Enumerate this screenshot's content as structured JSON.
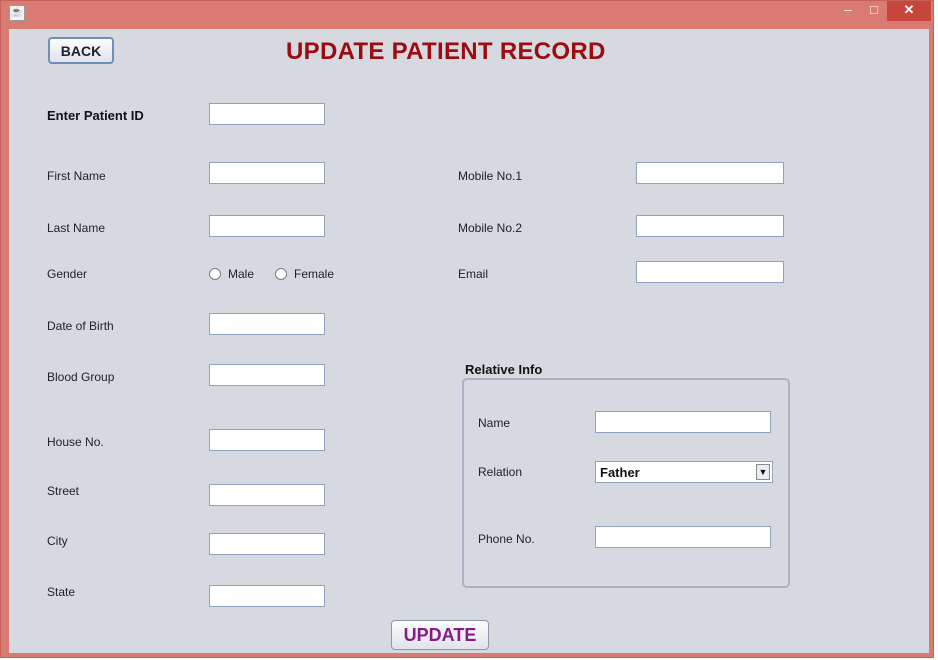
{
  "window": {
    "title": "",
    "controls": {
      "minimize": "–",
      "maximize": "□",
      "close": "✕"
    }
  },
  "header": {
    "back_label": "BACK",
    "title": "UPDATE PATIENT RECORD"
  },
  "form": {
    "patient_id_label": "Enter Patient ID",
    "first_name_label": "First Name",
    "last_name_label": "Last Name",
    "gender_label": "Gender",
    "gender_options": [
      "Male",
      "Female"
    ],
    "dob_label": "Date of Birth",
    "blood_group_label": "Blood Group",
    "house_no_label": "House No.",
    "street_label": "Street",
    "city_label": "City",
    "state_label": "State",
    "mobile1_label": "Mobile No.1",
    "mobile2_label": "Mobile No.2",
    "email_label": "Email"
  },
  "relative": {
    "title": "Relative Info",
    "name_label": "Name",
    "relation_label": "Relation",
    "relation_value": "Father",
    "phone_label": "Phone No."
  },
  "footer": {
    "update_label": "UPDATE"
  },
  "icons": {
    "app": "java-app-icon",
    "dropdown": "chevron-down-icon",
    "radio": "radio-button-icon"
  }
}
